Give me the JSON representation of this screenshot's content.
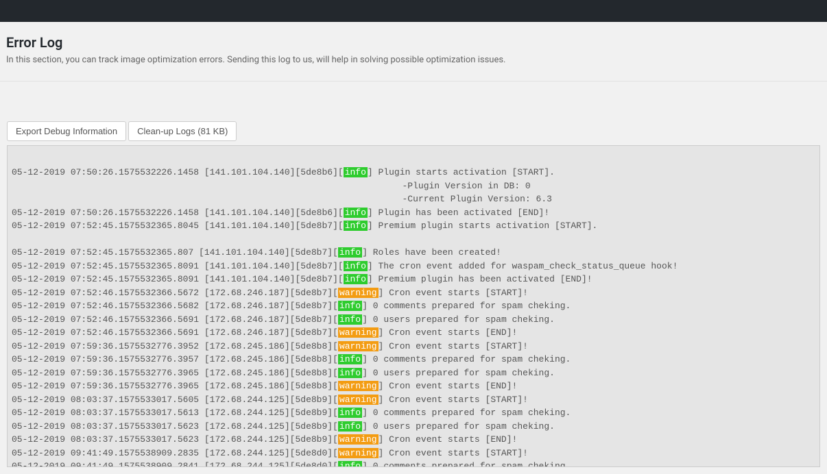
{
  "header": {
    "title": "Error Log",
    "description": "In this section, you can track image optimization errors. Sending this log to us, will help in solving possible optimization issues."
  },
  "buttons": {
    "export": "Export Debug Information",
    "cleanup": "Clean-up Logs (81 KB)"
  },
  "log_entries": [
    {
      "ts": "05-12-2019 07:50:26.1575532226.1458",
      "ip": "141.101.104.140",
      "sid": "5de8b6",
      "level": "info",
      "msg": "Plugin starts activation [START]."
    },
    {
      "indent_to_msg": true,
      "msg": "-Plugin Version in DB: 0"
    },
    {
      "indent_to_msg": true,
      "msg": "-Current Plugin Version: 6.3"
    },
    {
      "ts": "05-12-2019 07:50:26.1575532226.1458",
      "ip": "141.101.104.140",
      "sid": "5de8b6",
      "level": "info",
      "msg": "Plugin has been activated [END]!"
    },
    {
      "ts": "05-12-2019 07:52:45.1575532365.8045",
      "ip": "141.101.104.140",
      "sid": "5de8b7",
      "level": "info",
      "msg": "Premium plugin starts activation [START]."
    },
    {
      "blank": true
    },
    {
      "ts": "05-12-2019 07:52:45.1575532365.807",
      "ip": "141.101.104.140",
      "sid": "5de8b7",
      "level": "info",
      "msg": "Roles have been created!"
    },
    {
      "ts": "05-12-2019 07:52:45.1575532365.8091",
      "ip": "141.101.104.140",
      "sid": "5de8b7",
      "level": "info",
      "msg": "The cron event added for waspam_check_status_queue hook!"
    },
    {
      "ts": "05-12-2019 07:52:45.1575532365.8091",
      "ip": "141.101.104.140",
      "sid": "5de8b7",
      "level": "info",
      "msg": "Premium plugin has been activated [END]!"
    },
    {
      "ts": "05-12-2019 07:52:46.1575532366.5672",
      "ip": "172.68.246.187",
      "sid": "5de8b7",
      "level": "warning",
      "msg": "Cron event starts [START]!"
    },
    {
      "ts": "05-12-2019 07:52:46.1575532366.5682",
      "ip": "172.68.246.187",
      "sid": "5de8b7",
      "level": "info",
      "msg": "0 comments prepared for spam cheking."
    },
    {
      "ts": "05-12-2019 07:52:46.1575532366.5691",
      "ip": "172.68.246.187",
      "sid": "5de8b7",
      "level": "info",
      "msg": "0 users prepared for spam cheking."
    },
    {
      "ts": "05-12-2019 07:52:46.1575532366.5691",
      "ip": "172.68.246.187",
      "sid": "5de8b7",
      "level": "warning",
      "msg": "Cron event starts [END]!"
    },
    {
      "ts": "05-12-2019 07:59:36.1575532776.3952",
      "ip": "172.68.245.186",
      "sid": "5de8b8",
      "level": "warning",
      "msg": "Cron event starts [START]!"
    },
    {
      "ts": "05-12-2019 07:59:36.1575532776.3957",
      "ip": "172.68.245.186",
      "sid": "5de8b8",
      "level": "info",
      "msg": "0 comments prepared for spam cheking."
    },
    {
      "ts": "05-12-2019 07:59:36.1575532776.3965",
      "ip": "172.68.245.186",
      "sid": "5de8b8",
      "level": "info",
      "msg": "0 users prepared for spam cheking."
    },
    {
      "ts": "05-12-2019 07:59:36.1575532776.3965",
      "ip": "172.68.245.186",
      "sid": "5de8b8",
      "level": "warning",
      "msg": "Cron event starts [END]!"
    },
    {
      "ts": "05-12-2019 08:03:37.1575533017.5605",
      "ip": "172.68.244.125",
      "sid": "5de8b9",
      "level": "warning",
      "msg": "Cron event starts [START]!"
    },
    {
      "ts": "05-12-2019 08:03:37.1575533017.5613",
      "ip": "172.68.244.125",
      "sid": "5de8b9",
      "level": "info",
      "msg": "0 comments prepared for spam cheking."
    },
    {
      "ts": "05-12-2019 08:03:37.1575533017.5623",
      "ip": "172.68.244.125",
      "sid": "5de8b9",
      "level": "info",
      "msg": "0 users prepared for spam cheking."
    },
    {
      "ts": "05-12-2019 08:03:37.1575533017.5623",
      "ip": "172.68.244.125",
      "sid": "5de8b9",
      "level": "warning",
      "msg": "Cron event starts [END]!"
    },
    {
      "ts": "05-12-2019 09:41:49.1575538909.2835",
      "ip": "172.68.244.125",
      "sid": "5de8d0",
      "level": "warning",
      "msg": "Cron event starts [START]!"
    },
    {
      "ts": "05-12-2019 09:41:49.1575538909.2841",
      "ip": "172.68.244.125",
      "sid": "5de8d0",
      "level": "info",
      "msg": "0 comments prepared for spam cheking."
    }
  ]
}
